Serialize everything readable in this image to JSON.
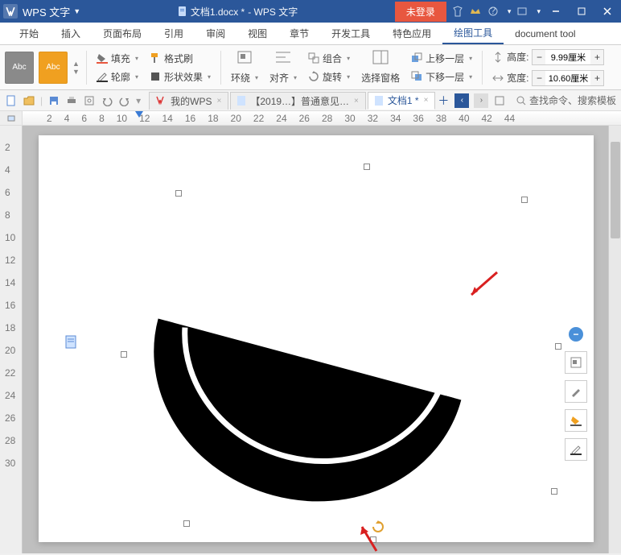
{
  "title": {
    "app": "WPS 文字",
    "doc": "文档1.docx *",
    "suffix": "- WPS 文字"
  },
  "titlebar": {
    "nolog": "未登录"
  },
  "menu": {
    "items": [
      "开始",
      "插入",
      "页面布局",
      "引用",
      "审阅",
      "视图",
      "章节",
      "开发工具",
      "特色应用",
      "绘图工具",
      "document tool"
    ],
    "active": 9
  },
  "ribbon": {
    "swatch_label": "Abc",
    "fill": "填充",
    "outline": "轮廓",
    "fmtpaint": "格式刷",
    "shapefx": "形状效果",
    "wrap": "环绕",
    "align": "对齐",
    "group": "组合",
    "rotate": "旋转",
    "selpane": "选择窗格",
    "upone": "上移一层",
    "downone": "下移一层",
    "height_lbl": "高度:",
    "width_lbl": "宽度:",
    "height_val": "9.99厘米",
    "width_val": "10.60厘米"
  },
  "qat": {
    "mywps": "我的WPS",
    "tab2": "【2019…】普通意见…",
    "tab3": "文档1 *",
    "search": "查找命令、搜索模板"
  },
  "ruler": {
    "h": [
      "2",
      "4",
      "6",
      "8",
      "10",
      "12",
      "14",
      "16",
      "18",
      "20",
      "22",
      "24",
      "26",
      "28",
      "30",
      "32",
      "34",
      "36",
      "38",
      "40",
      "42",
      "44"
    ]
  },
  "vruler": {
    "v": [
      "2",
      "4",
      "6",
      "8",
      "10",
      "12",
      "14",
      "16",
      "18",
      "20",
      "22",
      "24",
      "26",
      "28",
      "30"
    ]
  }
}
